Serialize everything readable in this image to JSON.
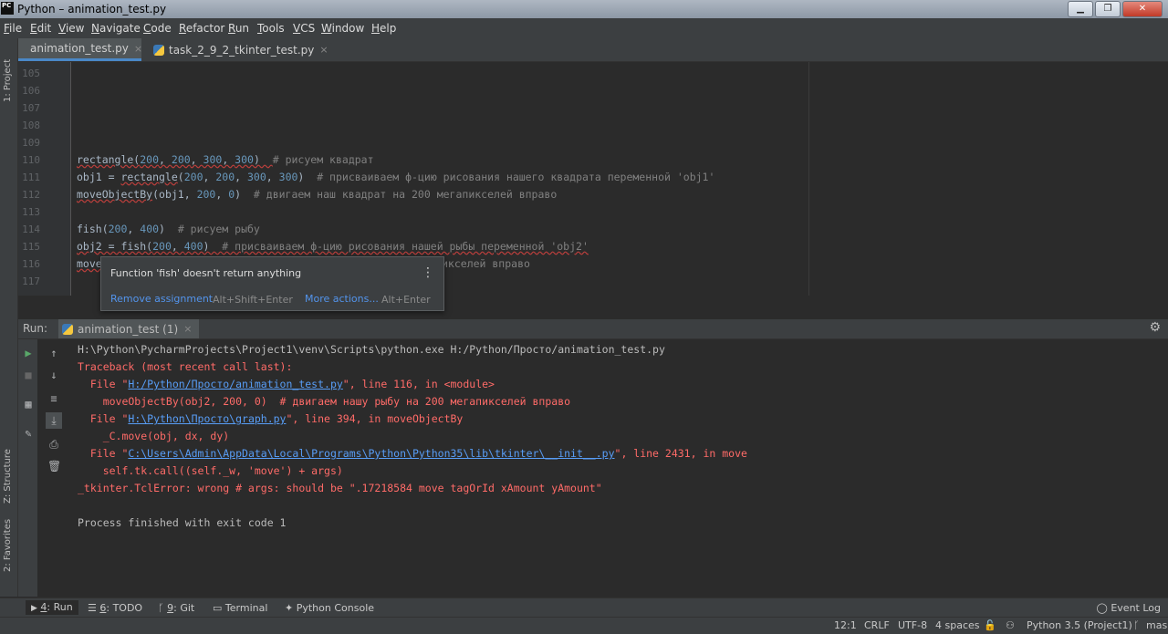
{
  "window": {
    "title": "Python – animation_test.py",
    "logo": "PC"
  },
  "window_buttons": {
    "minimize": "▁",
    "maximize": "❐",
    "close": "✕"
  },
  "menu": [
    "File",
    "Edit",
    "View",
    "Navigate",
    "Code",
    "Refactor",
    "Run",
    "Tools",
    "VCS",
    "Window",
    "Help"
  ],
  "left_stripe": {
    "project": "1: Project",
    "structure": "Z: Structure",
    "favorites": "2: Favorites"
  },
  "tabs": [
    {
      "label": "animation_test.py",
      "active": true,
      "close": "×"
    },
    {
      "label": "task_2_9_2_tkinter_test.py",
      "active": false,
      "close": "×"
    }
  ],
  "editor": {
    "line_numbers": [
      "105",
      "106",
      "107",
      "108",
      "109",
      "110",
      "111",
      "112",
      "113",
      "114",
      "115",
      "116",
      "117"
    ],
    "lines": {
      "l110": {
        "a": "rectangle(",
        "n1": "200",
        "s1": ", ",
        "n2": "200",
        "s2": ", ",
        "n3": "300",
        "s3": ", ",
        "n4": "300",
        "b": ")  ",
        "c": "# рисуем квадрат"
      },
      "l111": {
        "a": "obj1 = ",
        "fn": "rectangle",
        "b": "(",
        "n1": "200",
        "s1": ", ",
        "n2": "200",
        "s2": ", ",
        "n3": "300",
        "s3": ", ",
        "n4": "300",
        "d": ")  ",
        "c": "# присваиваем ф-цию рисования нашего квадрата переменной 'obj1'"
      },
      "l112": {
        "fn": "moveObjectBy",
        "a": "(obj1, ",
        "n1": "200",
        "s1": ", ",
        "n2": "0",
        "b": ")  ",
        "c": "# двигаем наш квадрат на 200 мегапикселей вправо"
      },
      "l114": {
        "a": "fish(",
        "n1": "200",
        "s1": ", ",
        "n2": "400",
        "b": ")  ",
        "c": "# рисуем рыбу"
      },
      "l115": {
        "a": "obj2 = fish(",
        "n1": "200",
        "s1": ", ",
        "n2": "400",
        "b": ")  ",
        "c": "# присваиваем ф-цию рисования нашей рыбы переменной 'obj2'"
      },
      "l116": {
        "a": "move",
        "c": "икселей вправо"
      }
    }
  },
  "popup": {
    "message": "Function 'fish' doesn't return anything",
    "menu_icon": "⋮",
    "action1": "Remove assignment",
    "shortcut1": "Alt+Shift+Enter",
    "action2": "More actions...",
    "shortcut2": "Alt+Enter"
  },
  "run_panel": {
    "label": "Run:",
    "tab": "animation_test (1)",
    "tab_close": "×",
    "settings_icon": "⚙",
    "output": {
      "cmd": "H:\\Python\\PycharmProjects\\Project1\\venv\\Scripts\\python.exe H:/Python/Просто/animation_test.py",
      "tb": "Traceback (most recent call last):",
      "f1_pre": "  File \"",
      "f1_link": "H:/Python/Просто/animation_test.py",
      "f1_post": "\", line 116, in <module>",
      "f1_code": "    moveObjectBy(obj2, 200, 0)  # двигаем нашу рыбу на 200 мегапикселей вправо",
      "f2_pre": "  File \"",
      "f2_link": "H:\\Python\\Просто\\graph.py",
      "f2_post": "\", line 394, in moveObjectBy",
      "f2_code": "    _C.move(obj, dx, dy)",
      "f3_pre": "  File \"",
      "f3_link": "C:\\Users\\Admin\\AppData\\Local\\Programs\\Python\\Python35\\lib\\tkinter\\__init__.py",
      "f3_post": "\", line 2431, in move",
      "f3_code": "    self.tk.call((self._w, 'move') + args)",
      "error": "_tkinter.TclError: wrong # args: should be \".17218584 move tagOrId xAmount yAmount\"",
      "exit": "Process finished with exit code 1"
    }
  },
  "bottom_tabs": [
    {
      "num": "4",
      "label": "Run"
    },
    {
      "num": "6",
      "label": "TODO"
    },
    {
      "num": "9",
      "label": "Git"
    },
    {
      "num": "",
      "label": "Terminal"
    },
    {
      "num": "",
      "label": "Python Console"
    }
  ],
  "event_log": "Event Log",
  "status": {
    "position": "12:1",
    "line_sep": "CRLF",
    "encoding": "UTF-8",
    "indent": "4 spaces",
    "interpreter": "Python 3.5 (Project1)",
    "branch": "mas"
  },
  "colors": {
    "accent": "#4a88c7",
    "error": "#ff6b68",
    "link": "#589df6",
    "run_green": "#59a869"
  }
}
